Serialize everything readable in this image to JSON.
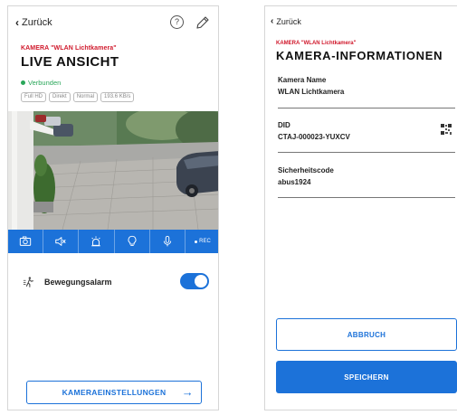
{
  "left": {
    "back_label": "Zurück",
    "help_glyph": "?",
    "camera_label": "KAMERA \"WLAN Lichtkamera\"",
    "title": "LIVE ANSICHT",
    "status": "Verbunden",
    "status_color": "#2aa75a",
    "badges": [
      "Full HD",
      "Direkt",
      "Normal",
      "193.6 KB/s"
    ],
    "toolbar": {
      "icons": [
        "camera-icon",
        "speaker-mute-icon",
        "siren-icon",
        "light-bulb-icon",
        "microphone-icon"
      ],
      "rec_label": "REC"
    },
    "motion_alarm": {
      "label": "Bewegungsalarm",
      "enabled": true
    },
    "settings_button": "KAMERAEINSTELLUNGEN",
    "settings_arrow": "→"
  },
  "right": {
    "back_label": "Zurück",
    "camera_label": "KAMERA \"WLAN Lichtkamera\"",
    "title": "KAMERA-INFORMATIONEN",
    "fields": [
      {
        "label": "Kamera Name",
        "value": "WLAN Lichtkamera"
      },
      {
        "label": "DID",
        "value": "CTAJ-000023-YUXCV"
      },
      {
        "label": "Sicherheitscode",
        "value": "abus1924"
      }
    ],
    "cancel_button": "ABBRUCH",
    "save_button": "SPEICHERN"
  },
  "colors": {
    "accent": "#1c72d9",
    "brand_red": "#d0182b"
  }
}
